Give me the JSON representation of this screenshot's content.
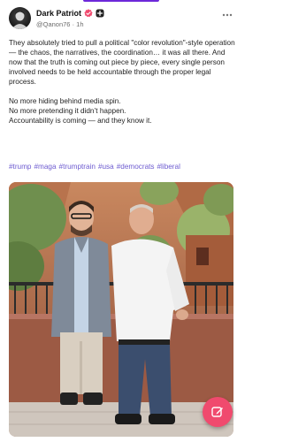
{
  "post": {
    "author": {
      "display_name": "Dark Patriot",
      "handle": "@Qanon76",
      "separator": "·",
      "time": "1h",
      "verified_badge_color": "#f04a6e",
      "add_badge_color": "#222222"
    },
    "paragraphs": [
      "They absolutely tried to pull a political \"color revolution\"-style operation — the chaos, the narratives, the coordination… it was all there. And now that the truth is coming out piece by piece, every single person involved needs to be held accountable through the proper legal process.",
      "No more hiding behind media spin.\nNo more pretending it didn’t happen.\nAccountability is coming — and they know it."
    ],
    "hashtags": [
      "#trump",
      "#maga",
      "#trumptrain",
      "#usa",
      "#democrats",
      "#liberal"
    ],
    "icons": {
      "more": "more-horizontal-icon",
      "compose": "compose-pencil-icon"
    }
  },
  "theme": {
    "accent": "#6d28d9",
    "hashtag": "#6d5bd0",
    "fab": "#f04a6e"
  }
}
